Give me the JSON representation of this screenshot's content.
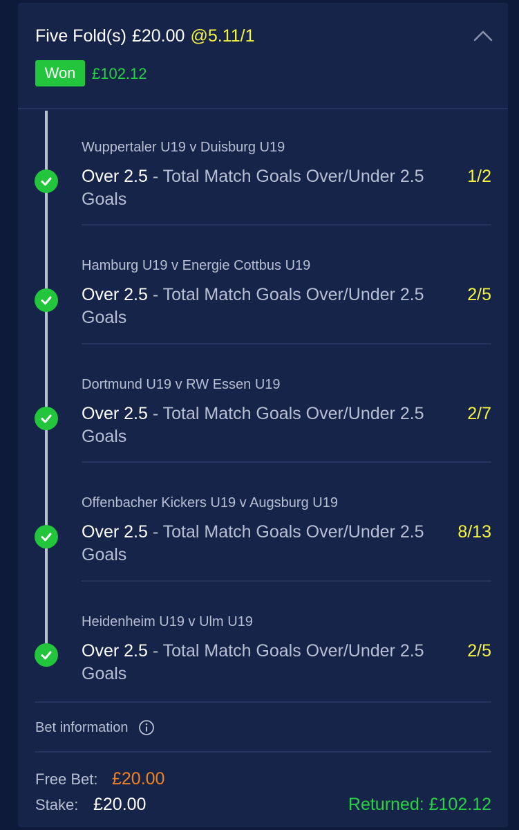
{
  "bet": {
    "type": "Five Fold(s)",
    "stake": "£20.00",
    "odds": "@5.11/1",
    "status": "Won",
    "won_amount": "£102.12"
  },
  "selections": [
    {
      "event": "Wuppertaler U19 v Duisburg U19",
      "selection": "Over 2.5",
      "market": " - Total Match Goals Over/Under 2.5 Goals",
      "price": "1/2"
    },
    {
      "event": "Hamburg U19 v Energie Cottbus U19",
      "selection": "Over 2.5",
      "market": " - Total Match Goals Over/Under 2.5 Goals",
      "price": "2/5"
    },
    {
      "event": "Dortmund U19 v RW Essen U19",
      "selection": "Over 2.5",
      "market": " - Total Match Goals Over/Under 2.5 Goals",
      "price": "2/7"
    },
    {
      "event": "Offenbacher Kickers U19 v Augsburg U19",
      "selection": "Over 2.5",
      "market": " - Total Match Goals Over/Under 2.5 Goals",
      "price": "8/13"
    },
    {
      "event": "Heidenheim U19 v Ulm U19",
      "selection": "Over 2.5",
      "market": " - Total Match Goals Over/Under 2.5 Goals",
      "price": "2/5"
    }
  ],
  "bet_information": {
    "label": "Bet information",
    "free_bet_label": "Free Bet:",
    "free_bet_value": "£20.00",
    "stake_label": "Stake:",
    "stake_value": "£20.00",
    "returned": "Returned: £102.12"
  },
  "icons": {
    "collapse": "chevron-up-icon",
    "check": "check-circle-icon",
    "info": "info-icon"
  },
  "colors": {
    "background": "#0e1a3a",
    "card": "#17244a",
    "won_green": "#22c53c",
    "odds_yellow": "#f5f53c",
    "free_bet_orange": "#f0821e"
  }
}
